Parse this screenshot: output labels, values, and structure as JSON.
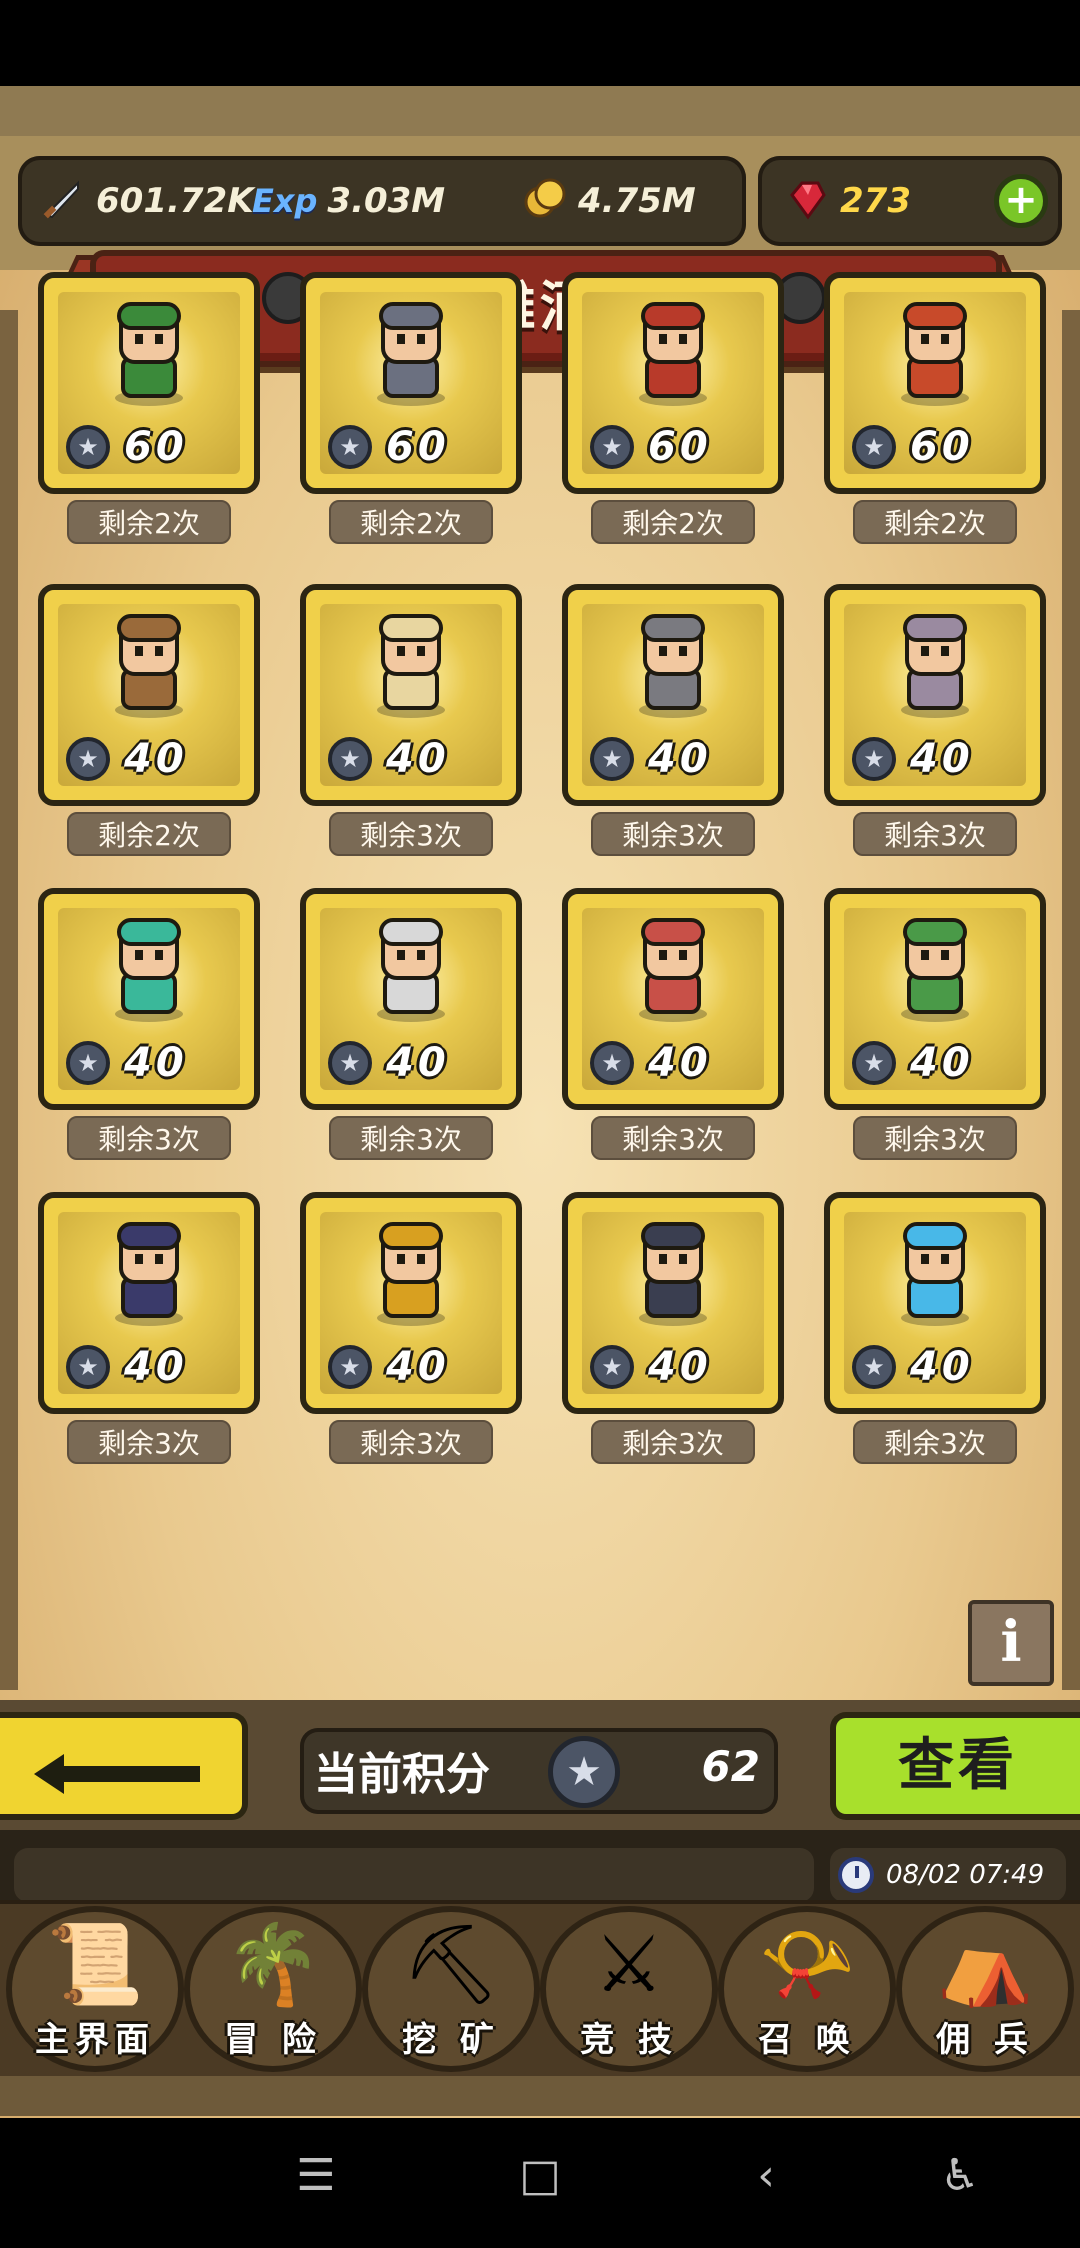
{
  "header": {
    "attack": "601.72K",
    "exp_label": "Exp",
    "exp": "3.03M",
    "gold": "4.75M",
    "gems": "273",
    "add_symbol": "+"
  },
  "title": "英雄酒馆",
  "heroes": [
    {
      "cost": "60",
      "remaining": "剩余2次",
      "color": "#3b8a3a"
    },
    {
      "cost": "60",
      "remaining": "剩余2次",
      "color": "#6b7080"
    },
    {
      "cost": "60",
      "remaining": "剩余2次",
      "color": "#b83a2a"
    },
    {
      "cost": "60",
      "remaining": "剩余2次",
      "color": "#c84a2a"
    },
    {
      "cost": "40",
      "remaining": "剩余2次",
      "color": "#9a6a3a"
    },
    {
      "cost": "40",
      "remaining": "剩余3次",
      "color": "#e8d6a0"
    },
    {
      "cost": "40",
      "remaining": "剩余3次",
      "color": "#7a7a80"
    },
    {
      "cost": "40",
      "remaining": "剩余3次",
      "color": "#9a8aa0"
    },
    {
      "cost": "40",
      "remaining": "剩余3次",
      "color": "#3ab89a"
    },
    {
      "cost": "40",
      "remaining": "剩余3次",
      "color": "#d8d8d8"
    },
    {
      "cost": "40",
      "remaining": "剩余3次",
      "color": "#c85048"
    },
    {
      "cost": "40",
      "remaining": "剩余3次",
      "color": "#4a9a48"
    },
    {
      "cost": "40",
      "remaining": "剩余3次",
      "color": "#3a3a6a"
    },
    {
      "cost": "40",
      "remaining": "剩余3次",
      "color": "#d8a020"
    },
    {
      "cost": "40",
      "remaining": "剩余3次",
      "color": "#3a3e50"
    },
    {
      "cost": "40",
      "remaining": "剩余3次",
      "color": "#48b8e8"
    }
  ],
  "info_label": "i",
  "score": {
    "label": "当前积分",
    "value": "62"
  },
  "view_button": "查看",
  "clock": "08/02 07:49",
  "nav": [
    {
      "label": "主界面",
      "glyph": "📜"
    },
    {
      "label": "冒 险",
      "glyph": "🌴"
    },
    {
      "label": "挖 矿",
      "glyph": "⛏"
    },
    {
      "label": "竞 技",
      "glyph": "⚔"
    },
    {
      "label": "召 唤",
      "glyph": "📯"
    },
    {
      "label": "佣 兵",
      "glyph": "⛺"
    }
  ],
  "system_nav": {
    "menu": "☰",
    "home": "□",
    "back": "‹",
    "accessibility": "♿"
  }
}
